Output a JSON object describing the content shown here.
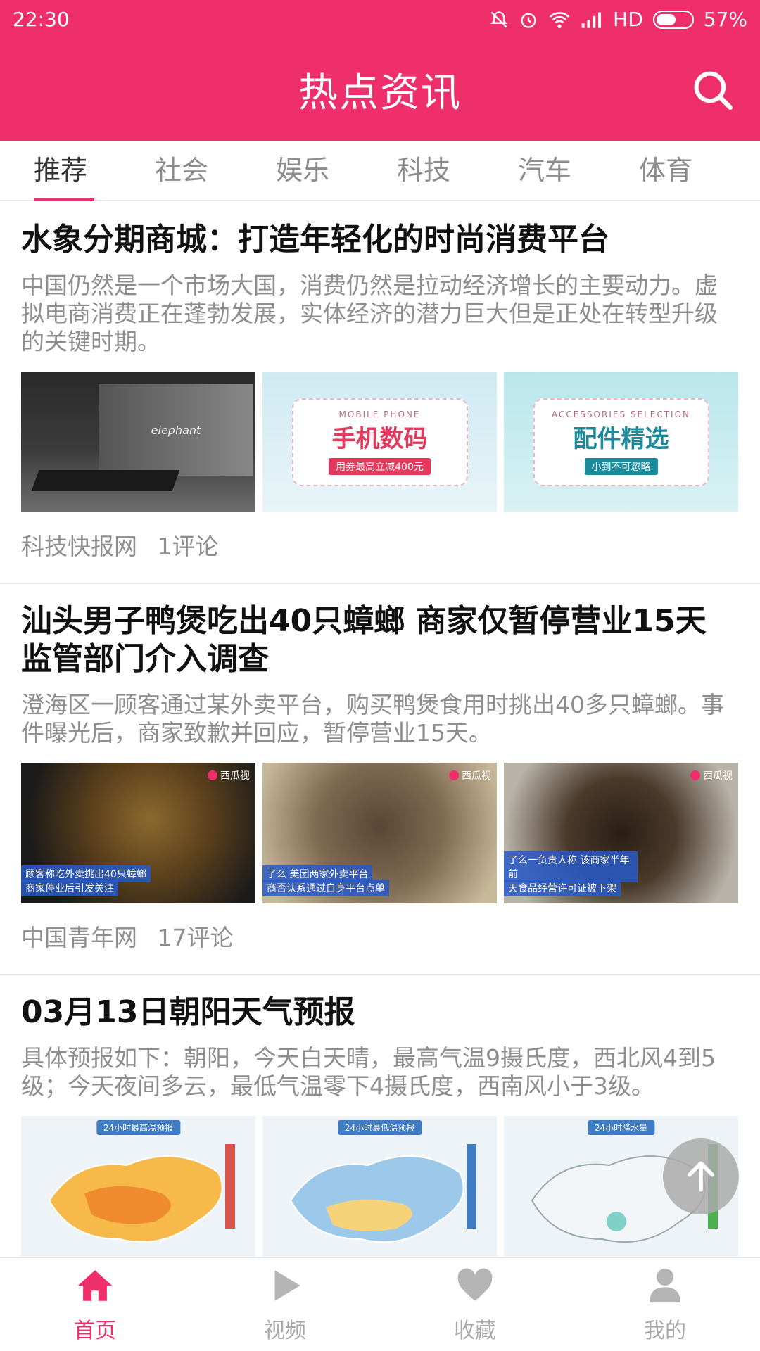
{
  "status_bar": {
    "time": "22:30",
    "network": "HD",
    "battery": "57%",
    "icons": [
      "mute-icon",
      "alarm-icon",
      "wifi-icon",
      "signal-icon",
      "battery-icon"
    ]
  },
  "app_bar": {
    "title": "热点资讯",
    "search_icon": "search-icon"
  },
  "tabs": [
    {
      "label": "推荐",
      "active": true
    },
    {
      "label": "社会",
      "active": false
    },
    {
      "label": "娱乐",
      "active": false
    },
    {
      "label": "科技",
      "active": false
    },
    {
      "label": "汽车",
      "active": false
    },
    {
      "label": "体育",
      "active": false
    }
  ],
  "articles": [
    {
      "title": "水象分期商城：打造年轻化的时尚消费平台",
      "summary": "中国仍然是一个市场大国，消费仍然是拉动经济增长的主要动力。虚拟电商消费正在蓬勃发展，实体经济的潜力巨大但是正处在转型升级的关键时期。",
      "images": [
        {
          "text": "elephant"
        },
        {
          "en": "MOBILE PHONE",
          "cn": "手机数码",
          "tag": "用券最高立减400元"
        },
        {
          "en": "ACCESSORIES SELECTION",
          "cn": "配件精选",
          "tag": "小到不可忽略"
        }
      ],
      "source": "科技快报网",
      "comments": "1评论"
    },
    {
      "title": "汕头男子鸭煲吃出40只蟑螂 商家仅暂停营业15天 监管部门介入调查",
      "summary": "澄海区一顾客通过某外卖平台，购买鸭煲食用时挑出40多只蟑螂。事件曝光后，商家致歉并回应，暂停营业15天。",
      "images": [
        {
          "line1": "顾客称吃外卖挑出40只蟑螂",
          "line2": "商家停业后引发关注",
          "wm": "西瓜视"
        },
        {
          "line1": "了么 美团两家外卖平台",
          "line2": "商否认系通过自身平台点单",
          "wm": "西瓜视"
        },
        {
          "line1": "了么一负责人称 该商家半年前",
          "line2": "天食品经营许可证被下架",
          "wm": "西瓜视"
        }
      ],
      "source": "中国青年网",
      "comments": "17评论"
    },
    {
      "title": "03月13日朝阳天气预报",
      "summary": "具体预报如下：朝阳，今天白天晴，最高气温9摄氏度，西北风4到5级；今天夜间多云，最低气温零下4摄氏度，西南风小于3级。",
      "images": [
        {
          "label": "24小时最高温预报"
        },
        {
          "label": "24小时最低温预报"
        },
        {
          "label": "24小时降水量"
        }
      ],
      "source": "",
      "comments": ""
    }
  ],
  "bottom_nav": [
    {
      "label": "首页",
      "icon": "home-icon",
      "active": true
    },
    {
      "label": "视频",
      "icon": "play-icon",
      "active": false
    },
    {
      "label": "收藏",
      "icon": "heart-icon",
      "active": false
    },
    {
      "label": "我的",
      "icon": "user-icon",
      "active": false
    }
  ],
  "colors": {
    "primary": "#ef2f6c",
    "text_dark": "#111111",
    "text_gray": "#8e8e8e"
  }
}
